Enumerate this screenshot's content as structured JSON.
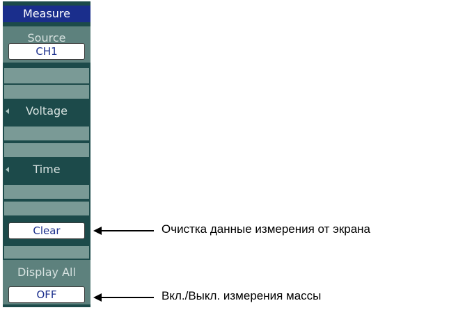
{
  "menu": {
    "title": "Measure",
    "source": {
      "label": "Source",
      "value": "CH1"
    },
    "voltage": {
      "label": "Voltage",
      "icon": "left-arrow-icon"
    },
    "time": {
      "label": "Time",
      "icon": "left-arrow-icon"
    },
    "clear": {
      "button": "Clear"
    },
    "display_all": {
      "label": "Display All",
      "value": "OFF"
    }
  },
  "annotations": {
    "clear_note": "Очистка данные измерения от экрана",
    "display_all_note": "Вкл./Выкл. измерения массы"
  },
  "colors": {
    "panel": "#1c4a4a",
    "title": "#1a2e8c",
    "label_block": "#5d817d"
  }
}
